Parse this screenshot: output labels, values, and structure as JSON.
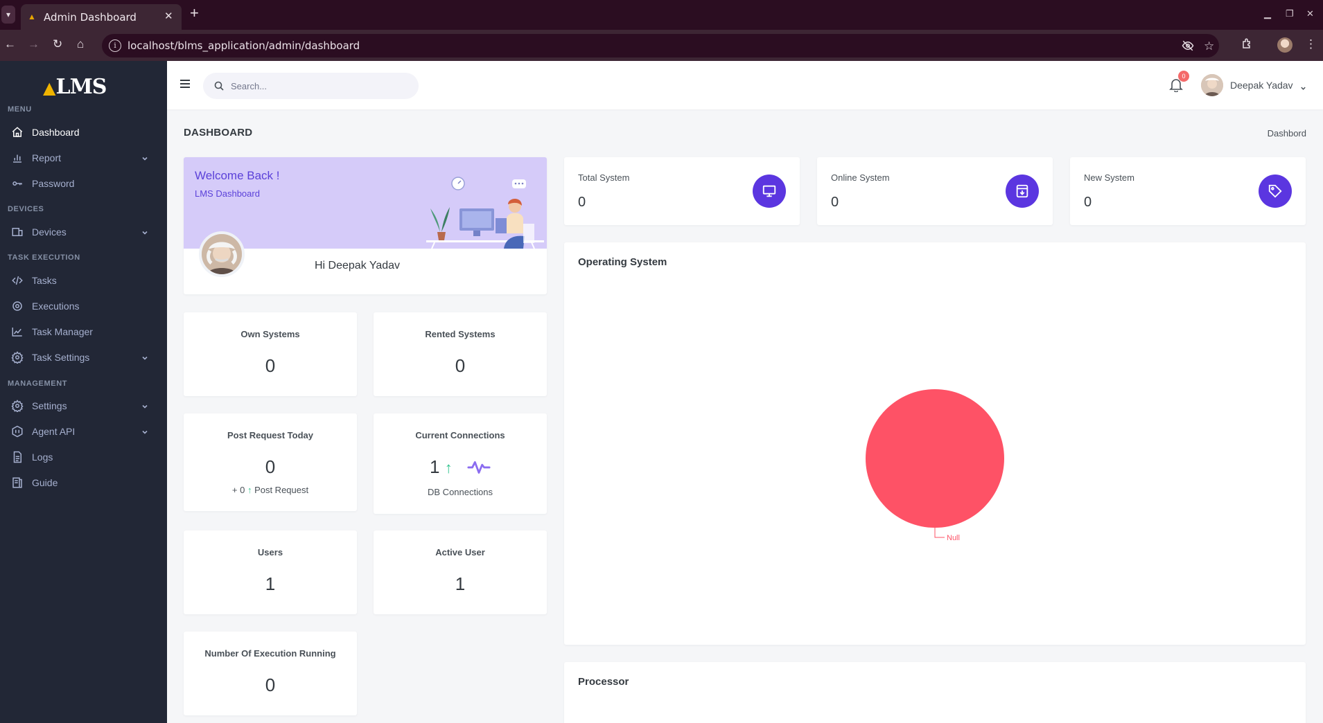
{
  "browser": {
    "tab_title": "Admin Dashboard",
    "url": "localhost/blms_application/admin/dashboard"
  },
  "sidebar": {
    "logo": "LMS",
    "sections": [
      {
        "title": "MENU",
        "items": [
          {
            "label": "Dashboard",
            "icon": "home-icon",
            "active": true,
            "chevron": false
          },
          {
            "label": "Report",
            "icon": "bar-chart-icon",
            "active": false,
            "chevron": true
          },
          {
            "label": "Password",
            "icon": "key-icon",
            "active": false,
            "chevron": false
          }
        ]
      },
      {
        "title": "DEVICES",
        "items": [
          {
            "label": "Devices",
            "icon": "devices-icon",
            "active": false,
            "chevron": true
          }
        ]
      },
      {
        "title": "TASK EXECUTION",
        "items": [
          {
            "label": "Tasks",
            "icon": "code-icon",
            "active": false,
            "chevron": false
          },
          {
            "label": "Executions",
            "icon": "gear-circle-icon",
            "active": false,
            "chevron": false
          },
          {
            "label": "Task Manager",
            "icon": "line-chart-icon",
            "active": false,
            "chevron": false
          },
          {
            "label": "Task Settings",
            "icon": "gear-icon",
            "active": false,
            "chevron": true
          }
        ]
      },
      {
        "title": "MANAGEMENT",
        "items": [
          {
            "label": "Settings",
            "icon": "gear-icon",
            "active": false,
            "chevron": true
          },
          {
            "label": "Agent API",
            "icon": "api-icon",
            "active": false,
            "chevron": true
          },
          {
            "label": "Logs",
            "icon": "file-icon",
            "active": false,
            "chevron": false
          },
          {
            "label": "Guide",
            "icon": "book-icon",
            "active": false,
            "chevron": false
          }
        ]
      }
    ]
  },
  "topbar": {
    "search_placeholder": "Search...",
    "notification_count": "0",
    "user_name": "Deepak Yadav"
  },
  "page": {
    "title": "DASHBOARD",
    "breadcrumb": "Dashbord"
  },
  "welcome": {
    "title": "Welcome Back !",
    "subtitle": "LMS Dashboard",
    "greeting": "Hi Deepak Yadav"
  },
  "stats": {
    "own_systems": {
      "title": "Own Systems",
      "value": "0"
    },
    "rented_systems": {
      "title": "Rented Systems",
      "value": "0"
    },
    "post_request": {
      "title": "Post Request Today",
      "value": "0",
      "sub_prefix": "+ 0",
      "sub_label": "Post Request"
    },
    "connections": {
      "title": "Current Connections",
      "value": "1",
      "sub_label": "DB Connections"
    },
    "users": {
      "title": "Users",
      "value": "1"
    },
    "active_user": {
      "title": "Active User",
      "value": "1"
    },
    "executions": {
      "title": "Number Of Execution Running",
      "value": "0"
    }
  },
  "kpis": {
    "total": {
      "title": "Total System",
      "value": "0",
      "icon": "monitor-icon"
    },
    "online": {
      "title": "Online System",
      "value": "0",
      "icon": "archive-in-icon"
    },
    "new": {
      "title": "New System",
      "value": "0",
      "icon": "tag-icon"
    }
  },
  "colors": {
    "sidebar_bg": "#222736",
    "accent": "#5b36e0",
    "welcome_bg": "#d5cbf9",
    "pie": "#fe5266",
    "up": "#34c38f"
  },
  "charts": {
    "os_title": "Operating System",
    "processor_title": "Processor"
  },
  "chart_data": {
    "type": "pie",
    "title": "Operating System",
    "categories": [
      "Null"
    ],
    "values": [
      1
    ],
    "colors": [
      "#fe5266"
    ]
  }
}
